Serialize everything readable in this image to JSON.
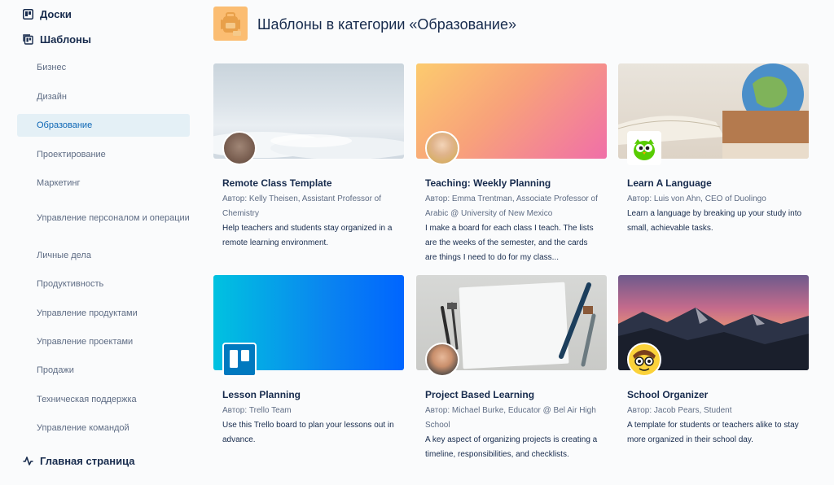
{
  "sidebar": {
    "boards_label": "Доски",
    "templates_label": "Шаблоны",
    "categories": [
      "Бизнес",
      "Дизайн",
      "Образование",
      "Проектирование",
      "Маркетинг",
      "Управление персоналом и операции",
      "Личные дела",
      "Продуктивность",
      "Управление продуктами",
      "Управление проектами",
      "Продажи",
      "Техническая поддержка",
      "Управление командой"
    ],
    "active_category": "Образование",
    "home_label": "Главная страница"
  },
  "header": {
    "title": "Шаблоны в категории «Образование»"
  },
  "cards": [
    {
      "title": "Remote Class Template",
      "author": "Автор: Kelly Theisen, Assistant Professor of Chemistry",
      "description": "Help teachers and students stay organized in a remote learning environment."
    },
    {
      "title": "Teaching: Weekly Planning",
      "author": "Автор: Emma Trentman, Associate Professor of Arabic @ University of New Mexico",
      "description": "I make a board for each class I teach. The lists are the weeks of the semester, and the cards are things I need to do for my class..."
    },
    {
      "title": "Learn A Language",
      "author": "Автор: Luis von Ahn, CEO of Duolingo",
      "description": "Learn a language by breaking up your study into small, achievable tasks."
    },
    {
      "title": "Lesson Planning",
      "author": "Автор: Trello Team",
      "description": "Use this Trello board to plan your lessons out in advance."
    },
    {
      "title": "Project Based Learning",
      "author": "Автор: Michael Burke, Educator @ Bel Air High School",
      "description": "A key aspect of organizing projects is creating a timeline, responsibilities, and checklists."
    },
    {
      "title": "School Organizer",
      "author": "Автор: Jacob Pears, Student",
      "description": "A template for students or teachers alike to stay more organized in their school day."
    }
  ],
  "colors": {
    "active_bg": "#e4f0f6",
    "active_text": "#0c66b5",
    "text_primary": "#172b4d",
    "text_secondary": "#5e6c84"
  }
}
